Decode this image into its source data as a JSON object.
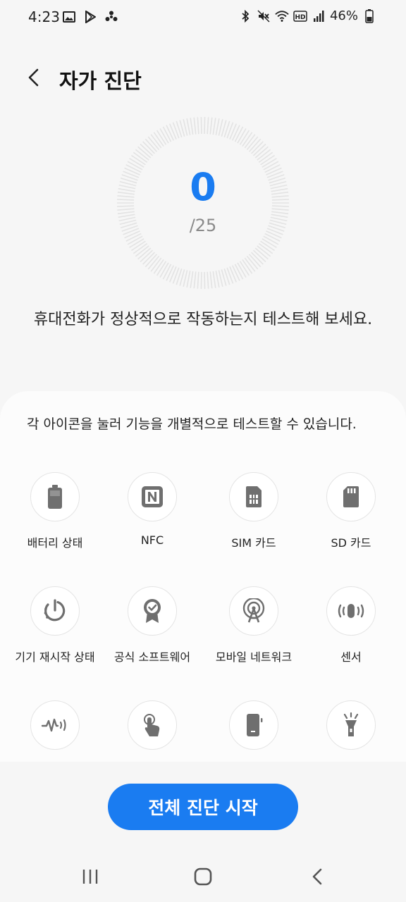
{
  "status_bar": {
    "time": "4:23",
    "battery_percent": "46%",
    "left_icons": [
      "gallery-icon",
      "play-store-icon",
      "fan-icon"
    ],
    "right_icons": [
      "bluetooth-icon",
      "mute-icon",
      "wifi-icon",
      "hd-icon",
      "signal-icon",
      "battery-icon"
    ]
  },
  "header": {
    "title": "자가 진단"
  },
  "progress": {
    "count": "0",
    "total": "/25"
  },
  "intro_text": "휴대전화가 정상적으로 작동하는지 테스트해 보세요.",
  "card": {
    "description": "각 아이콘을 눌러 기능을 개별적으로 테스트할 수 있습니다.",
    "tests": [
      {
        "label": "배터리 상태",
        "icon": "battery-icon"
      },
      {
        "label": "NFC",
        "icon": "nfc-icon"
      },
      {
        "label": "SIM 카드",
        "icon": "sim-card-icon"
      },
      {
        "label": "SD 카드",
        "icon": "sd-card-icon"
      },
      {
        "label": "기기 재시작 상태",
        "icon": "restart-icon"
      },
      {
        "label": "공식 소프트웨어",
        "icon": "certified-badge-icon"
      },
      {
        "label": "모바일 네트워크",
        "icon": "antenna-icon"
      },
      {
        "label": "센서",
        "icon": "sensor-icon"
      },
      {
        "label": "",
        "icon": "heartbeat-icon"
      },
      {
        "label": "",
        "icon": "touch-icon"
      },
      {
        "label": "",
        "icon": "screen-icon"
      },
      {
        "label": "",
        "icon": "flashlight-icon"
      }
    ]
  },
  "start_button": {
    "label": "전체 진단 시작"
  },
  "colors": {
    "accent": "#1a7cf1",
    "background": "#f6f6f6",
    "icon_gray": "#6f6f6f"
  },
  "nav": {
    "buttons": [
      "recents-icon",
      "home-icon",
      "back-icon"
    ]
  }
}
